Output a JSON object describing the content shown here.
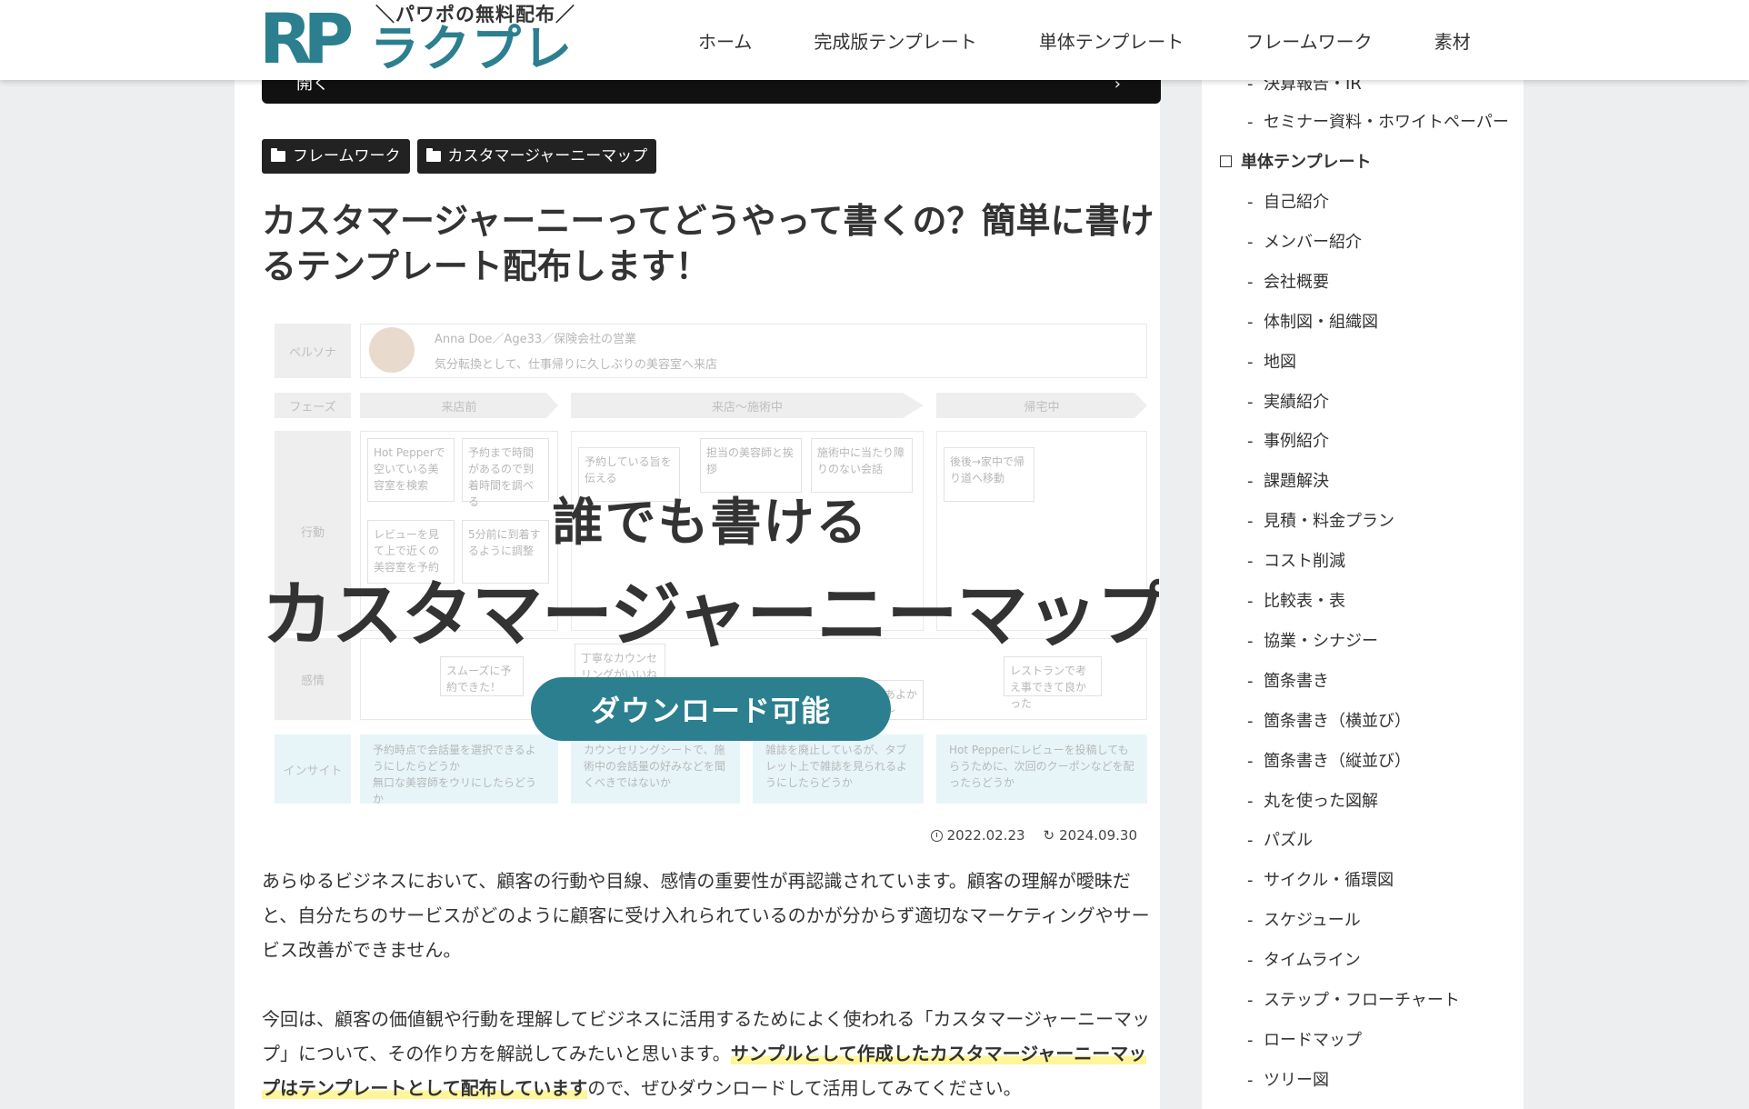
{
  "header": {
    "logo_mark": "RP",
    "logo_tagline": "＼パワポの無料配布／",
    "logo_name": "ラクプレ",
    "nav": [
      "ホーム",
      "完成版テンプレート",
      "単体テンプレート",
      "フレームワーク",
      "素材"
    ]
  },
  "toc_bar": {
    "label": "開く",
    "chevron": "›"
  },
  "categories": [
    "フレームワーク",
    "カスタマージャーニーマップ"
  ],
  "article": {
    "title": "カスタマージャーニーってどうやって書くの？簡単に書けるテンプレート配布します！",
    "published": "2022.02.23",
    "updated": "2024.09.30",
    "para1": "あらゆるビジネスにおいて、顧客の行動や目線、感情の重要性が再認識されています。顧客の理解が曖昧だと、自分たちのサービスがどのように顧客に受け入れられているのかが分からず適切なマーケティングやサービス改善ができません。",
    "para2_start": "今回は、顧客の価値観や行動を理解してビジネスに活用するためによく使われる「カスタマージャーニーマップ」について、その作り方を解説してみたいと思います。",
    "para2_highlight": "サンプルとして作成したカスタマージャーニーマップはテンプレートとして配布しています",
    "para2_end": "ので、ぜひダウンロードして活用してみてください。"
  },
  "eyecatch": {
    "overlay_line1": "誰でも書ける",
    "overlay_line2": "カスタマージャーニーマップ",
    "overlay_button": "ダウンロード可能",
    "persona_label": "ペルソナ",
    "persona_name": "Anna Doe／Age33／保険会社の営業",
    "persona_desc": "気分転換として、仕事帰りに久しぶりの美容室へ来店",
    "phase_label": "フェーズ",
    "phases": [
      "来店前",
      "来店～施術中",
      "帰宅中"
    ],
    "action_label": "行動",
    "emotion_label": "感情",
    "insight_label": "インサイト",
    "cards": [
      "Hot Pepperで空いている美容室を検索",
      "予約まで時間があるので到着時間を調べる",
      "予約している旨を伝える",
      "担当の美容師と挨拶",
      "施術中に当たり障りのない会話",
      "後後→家中で帰り道へ移動",
      "レビューを見て上で近くの美容室を予約",
      "5分前に到着するように調整",
      "スムーズに予約できた！",
      "丁寧なカウンセリングがいいね",
      "施術はまあよかったかな〜",
      "レストランで考え事できて良かった"
    ],
    "insights": [
      "予約時点で会話量を選択できるようにしたらどうか",
      "無口な美容師をウリにしたらどうか",
      "カウンセリングシートで、施術中の会話量の好みなどを聞くべきではないか",
      "雑誌を廃止しているが、タブレット上で雑誌を見られるようにしたらどうか",
      "Hot Pepperにレビューを投稿してもらうために、次回のクーポンなどを配ったらどうか"
    ]
  },
  "sidebar": {
    "top_items": [
      "決算報告・IR",
      "セミナー資料・ホワイトペーパー"
    ],
    "section_title": "単体テンプレート",
    "items": [
      "自己紹介",
      "メンバー紹介",
      "会社概要",
      "体制図・組織図",
      "地図",
      "実績紹介",
      "事例紹介",
      "課題解決",
      "見積・料金プラン",
      "コスト削減",
      "比較表・表",
      "協業・シナジー",
      "箇条書き",
      "箇条書き（横並び）",
      "箇条書き（縦並び）",
      "丸を使った図解",
      "パズル",
      "サイクル・循環図",
      "スケジュール",
      "タイムライン",
      "ステップ・フローチャート",
      "ロードマップ",
      "ツリー図"
    ]
  }
}
